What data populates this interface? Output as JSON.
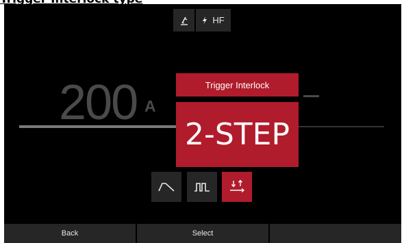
{
  "caption": "Trigger Interlock type",
  "status_bar": {
    "hf_label": "HF",
    "torch_icon": "torch-icon",
    "lightning_icon": "lightning-icon"
  },
  "current": {
    "value": "200",
    "unit": "A"
  },
  "popup": {
    "title": "Trigger Interlock",
    "value": "2-STEP"
  },
  "modes": [
    {
      "icon": "slope-icon",
      "selected": false
    },
    {
      "icon": "pulse-icon",
      "selected": false
    },
    {
      "icon": "two-step-icon",
      "selected": true
    }
  ],
  "softkeys": [
    "Back",
    "Select",
    ""
  ],
  "colors": {
    "accent": "#b01c2c",
    "button": "#262626",
    "background": "#000000",
    "dim_text": "#4a4a4a"
  }
}
